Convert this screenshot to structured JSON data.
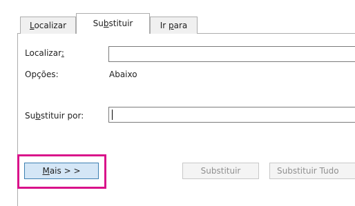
{
  "tabs": {
    "localizar": {
      "pre": "",
      "key": "L",
      "post": "ocalizar"
    },
    "substituir": {
      "pre": "Su",
      "key": "b",
      "post": "stituir"
    },
    "ir_para": {
      "pre": "Ir ",
      "key": "p",
      "post": "ara"
    }
  },
  "fields": {
    "localizar_label": {
      "pre": "Localizar",
      "key": ":",
      "post": ""
    },
    "opcoes_label": "Opções:",
    "opcoes_value": "Abaixo",
    "substituir_por_label": {
      "pre": "Su",
      "key": "b",
      "post": "stituir por:"
    },
    "localizar_value": "",
    "substituir_por_value": ""
  },
  "buttons": {
    "mais": {
      "pre": "",
      "key": "M",
      "post": "ais > >"
    },
    "substituir": "Substituir",
    "substituir_tudo": "Substituir Tudo"
  },
  "colors": {
    "highlight": "#d9118a",
    "primary_button": "#d4e6f6"
  }
}
